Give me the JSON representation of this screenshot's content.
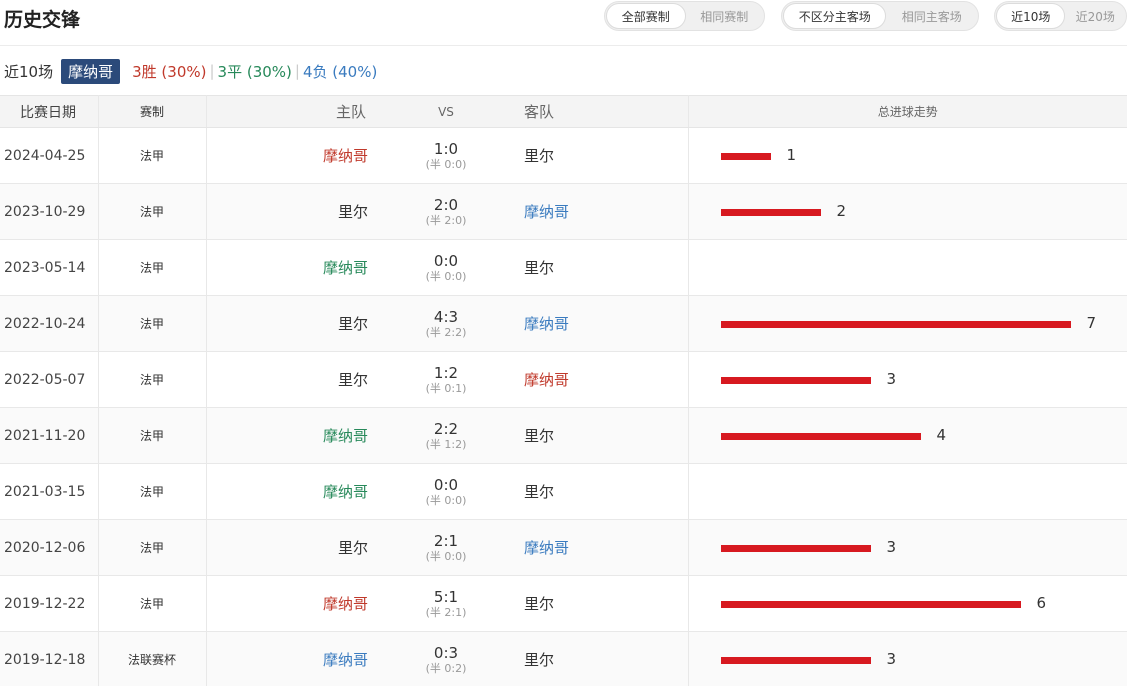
{
  "header": {
    "title": "历史交锋",
    "filter_competition": [
      "全部赛制",
      "相同赛制"
    ],
    "filter_venue": [
      "不区分主客场",
      "相同主客场"
    ],
    "filter_count": [
      "近10场",
      "近20场"
    ]
  },
  "summary": {
    "recent": "近10场",
    "team": "摩纳哥",
    "wins": "3胜 (30%)",
    "draws": "3平 (30%)",
    "losses": "4负 (40%)"
  },
  "table": {
    "columns": [
      "比赛日期",
      "赛制",
      "主队",
      "VS",
      "客队",
      "总进球走势"
    ],
    "max_goals": 7,
    "rows": [
      {
        "date": "2024-04-25",
        "comp": "法甲",
        "home": "摩纳哥",
        "home_color": "red",
        "score": "1:0",
        "half": "(半 0:0)",
        "away": "里尔",
        "away_color": "plain",
        "goals": 1
      },
      {
        "date": "2023-10-29",
        "comp": "法甲",
        "home": "里尔",
        "home_color": "plain",
        "score": "2:0",
        "half": "(半 2:0)",
        "away": "摩纳哥",
        "away_color": "blue",
        "goals": 2
      },
      {
        "date": "2023-05-14",
        "comp": "法甲",
        "home": "摩纳哥",
        "home_color": "green",
        "score": "0:0",
        "half": "(半 0:0)",
        "away": "里尔",
        "away_color": "plain",
        "goals": 0
      },
      {
        "date": "2022-10-24",
        "comp": "法甲",
        "home": "里尔",
        "home_color": "plain",
        "score": "4:3",
        "half": "(半 2:2)",
        "away": "摩纳哥",
        "away_color": "blue",
        "goals": 7
      },
      {
        "date": "2022-05-07",
        "comp": "法甲",
        "home": "里尔",
        "home_color": "plain",
        "score": "1:2",
        "half": "(半 0:1)",
        "away": "摩纳哥",
        "away_color": "red",
        "goals": 3
      },
      {
        "date": "2021-11-20",
        "comp": "法甲",
        "home": "摩纳哥",
        "home_color": "green",
        "score": "2:2",
        "half": "(半 1:2)",
        "away": "里尔",
        "away_color": "plain",
        "goals": 4
      },
      {
        "date": "2021-03-15",
        "comp": "法甲",
        "home": "摩纳哥",
        "home_color": "green",
        "score": "0:0",
        "half": "(半 0:0)",
        "away": "里尔",
        "away_color": "plain",
        "goals": 0
      },
      {
        "date": "2020-12-06",
        "comp": "法甲",
        "home": "里尔",
        "home_color": "plain",
        "score": "2:1",
        "half": "(半 0:0)",
        "away": "摩纳哥",
        "away_color": "blue",
        "goals": 3
      },
      {
        "date": "2019-12-22",
        "comp": "法甲",
        "home": "摩纳哥",
        "home_color": "red",
        "score": "5:1",
        "half": "(半 2:1)",
        "away": "里尔",
        "away_color": "plain",
        "goals": 6
      },
      {
        "date": "2019-12-18",
        "comp": "法联赛杯",
        "home": "摩纳哥",
        "home_color": "blue",
        "score": "0:3",
        "half": "(半 0:2)",
        "away": "里尔",
        "away_color": "plain",
        "goals": 3
      }
    ]
  },
  "colors": {
    "win": "#c0392b",
    "draw": "#27895a",
    "loss": "#3a7bbf",
    "bar": "#d71920",
    "badge": "#2b4a7a"
  }
}
